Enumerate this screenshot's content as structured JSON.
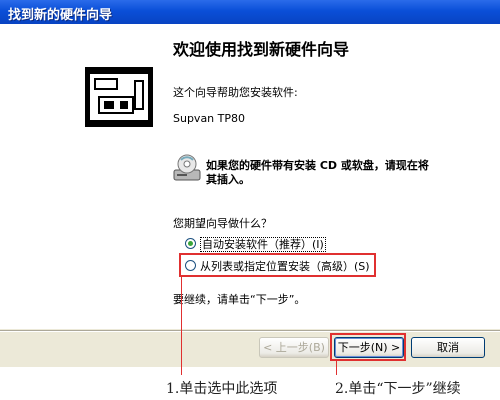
{
  "window": {
    "title": "找到新的硬件向导"
  },
  "content": {
    "heading": "欢迎使用找到新硬件向导",
    "intro": "这个向导帮助您安装软件:",
    "device_name": "Supvan TP80",
    "cd_prompt_line1": "如果您的硬件带有安装 CD 或软盘，请现在将",
    "cd_prompt_line2": "其插入。",
    "question": "您期望向导做什么？",
    "options": [
      {
        "label": "自动安装软件（推荐）(I)",
        "checked": true
      },
      {
        "label": "从列表或指定位置安装（高级）(S)",
        "checked": false
      }
    ],
    "continue_text": "要继续，请单击“下一步”。"
  },
  "buttons": {
    "back": "< 上一步(B)",
    "next": "下一步(N) >",
    "cancel": "取消"
  },
  "annotations": {
    "step1": "1.单击选中此选项",
    "step2": "2.单击“下一步”继续"
  },
  "colors": {
    "title_bar": "#0a4fd8",
    "annotation_red": "#e03030",
    "dialog_bg": "#ece9d8"
  }
}
